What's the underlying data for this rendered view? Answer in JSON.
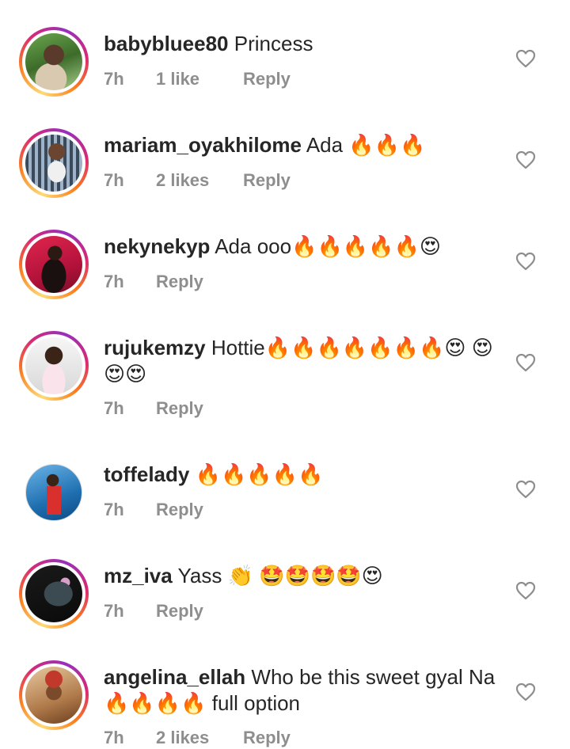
{
  "comments": [
    {
      "username": "babybluee80",
      "text": "Princess",
      "time": "7h",
      "likes": "1 like",
      "reply": "Reply"
    },
    {
      "username": "mariam_oyakhilome",
      "text": "Ada 🔥🔥🔥",
      "time": "7h",
      "likes": "2 likes",
      "reply": "Reply"
    },
    {
      "username": "nekynekyp",
      "text": "Ada ooo🔥🔥🔥🔥🔥😍",
      "time": "7h",
      "likes": "",
      "reply": "Reply"
    },
    {
      "username": "rujukemzy",
      "text": "Hottie🔥🔥🔥🔥🔥🔥🔥😍 😍😍😍",
      "time": "7h",
      "likes": "",
      "reply": "Reply"
    },
    {
      "username": "toffelady",
      "text": "🔥🔥🔥🔥🔥",
      "time": "7h",
      "likes": "",
      "reply": "Reply"
    },
    {
      "username": "mz_iva",
      "text": "Yass 👏 🤩🤩🤩🤩😍",
      "time": "7h",
      "likes": "",
      "reply": "Reply"
    },
    {
      "username": "angelina_ellah",
      "text": "Who be this sweet gyal Na 🔥🔥🔥🔥 full option",
      "time": "7h",
      "likes": "2 likes",
      "reply": "Reply"
    }
  ],
  "icons": {
    "like": "heart-outline-icon"
  },
  "colors": {
    "text": "#262626",
    "meta": "#8e8e8e",
    "heart": "#8e8e8e"
  }
}
